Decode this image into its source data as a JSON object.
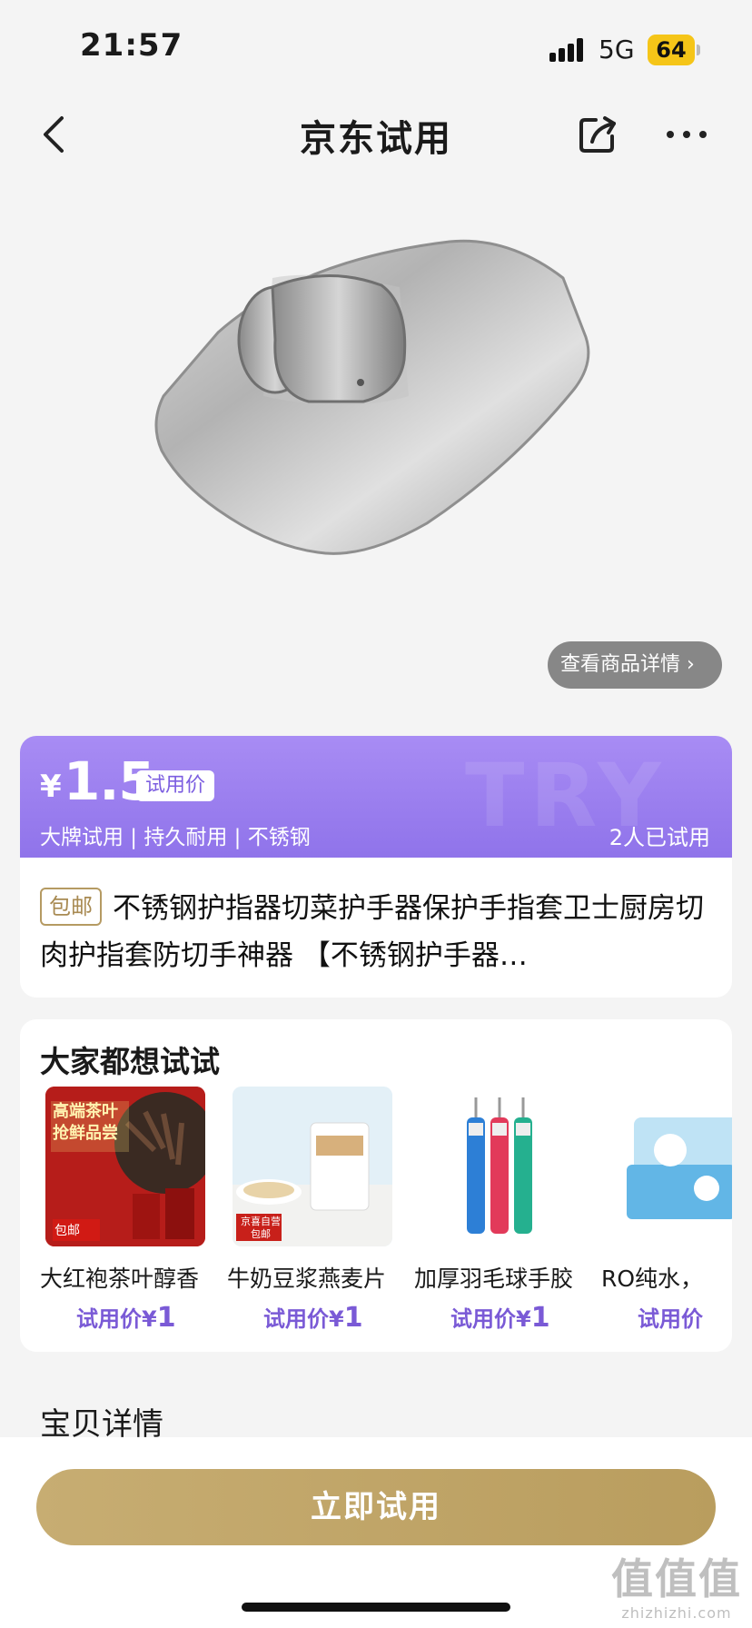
{
  "status_bar": {
    "time": "21:57",
    "network": "5G",
    "battery": "64"
  },
  "nav": {
    "title": "京东试用"
  },
  "product": {
    "detail_link": "查看商品详情 ›"
  },
  "price": {
    "currency": "¥",
    "value": "1.5",
    "tag": "试用价",
    "features": "大牌试用 | 持久耐用 | 不锈钢",
    "tried_count": "2人已试用",
    "watermark": "TRY"
  },
  "title": {
    "badge": "包邮",
    "text": "不锈钢护指器切菜护手器保护手指套卫士厨房切肉护指套防切手神器 【不锈钢护手器…"
  },
  "recommend": {
    "title": "大家都想试试",
    "items": [
      {
        "name": "大红袍茶叶醇香",
        "price_label": "试用价¥",
        "price": "1",
        "thumb_text_1": "高端茶叶",
        "thumb_text_2": "抢鲜品尝",
        "thumb_badge": "包邮"
      },
      {
        "name": "牛奶豆浆燕麦片",
        "price_label": "试用价¥",
        "price": "1",
        "thumb_badge": "京喜自营 包邮"
      },
      {
        "name": "加厚羽毛球手胶",
        "price_label": "试用价¥",
        "price": "1"
      },
      {
        "name": "RO纯水，",
        "price_label": "试用价",
        "price": ""
      }
    ]
  },
  "section": {
    "title": "宝贝详情"
  },
  "cta": {
    "label": "立即试用"
  },
  "watermark": {
    "big": "值值值",
    "small": "zhizhizhi.com"
  }
}
